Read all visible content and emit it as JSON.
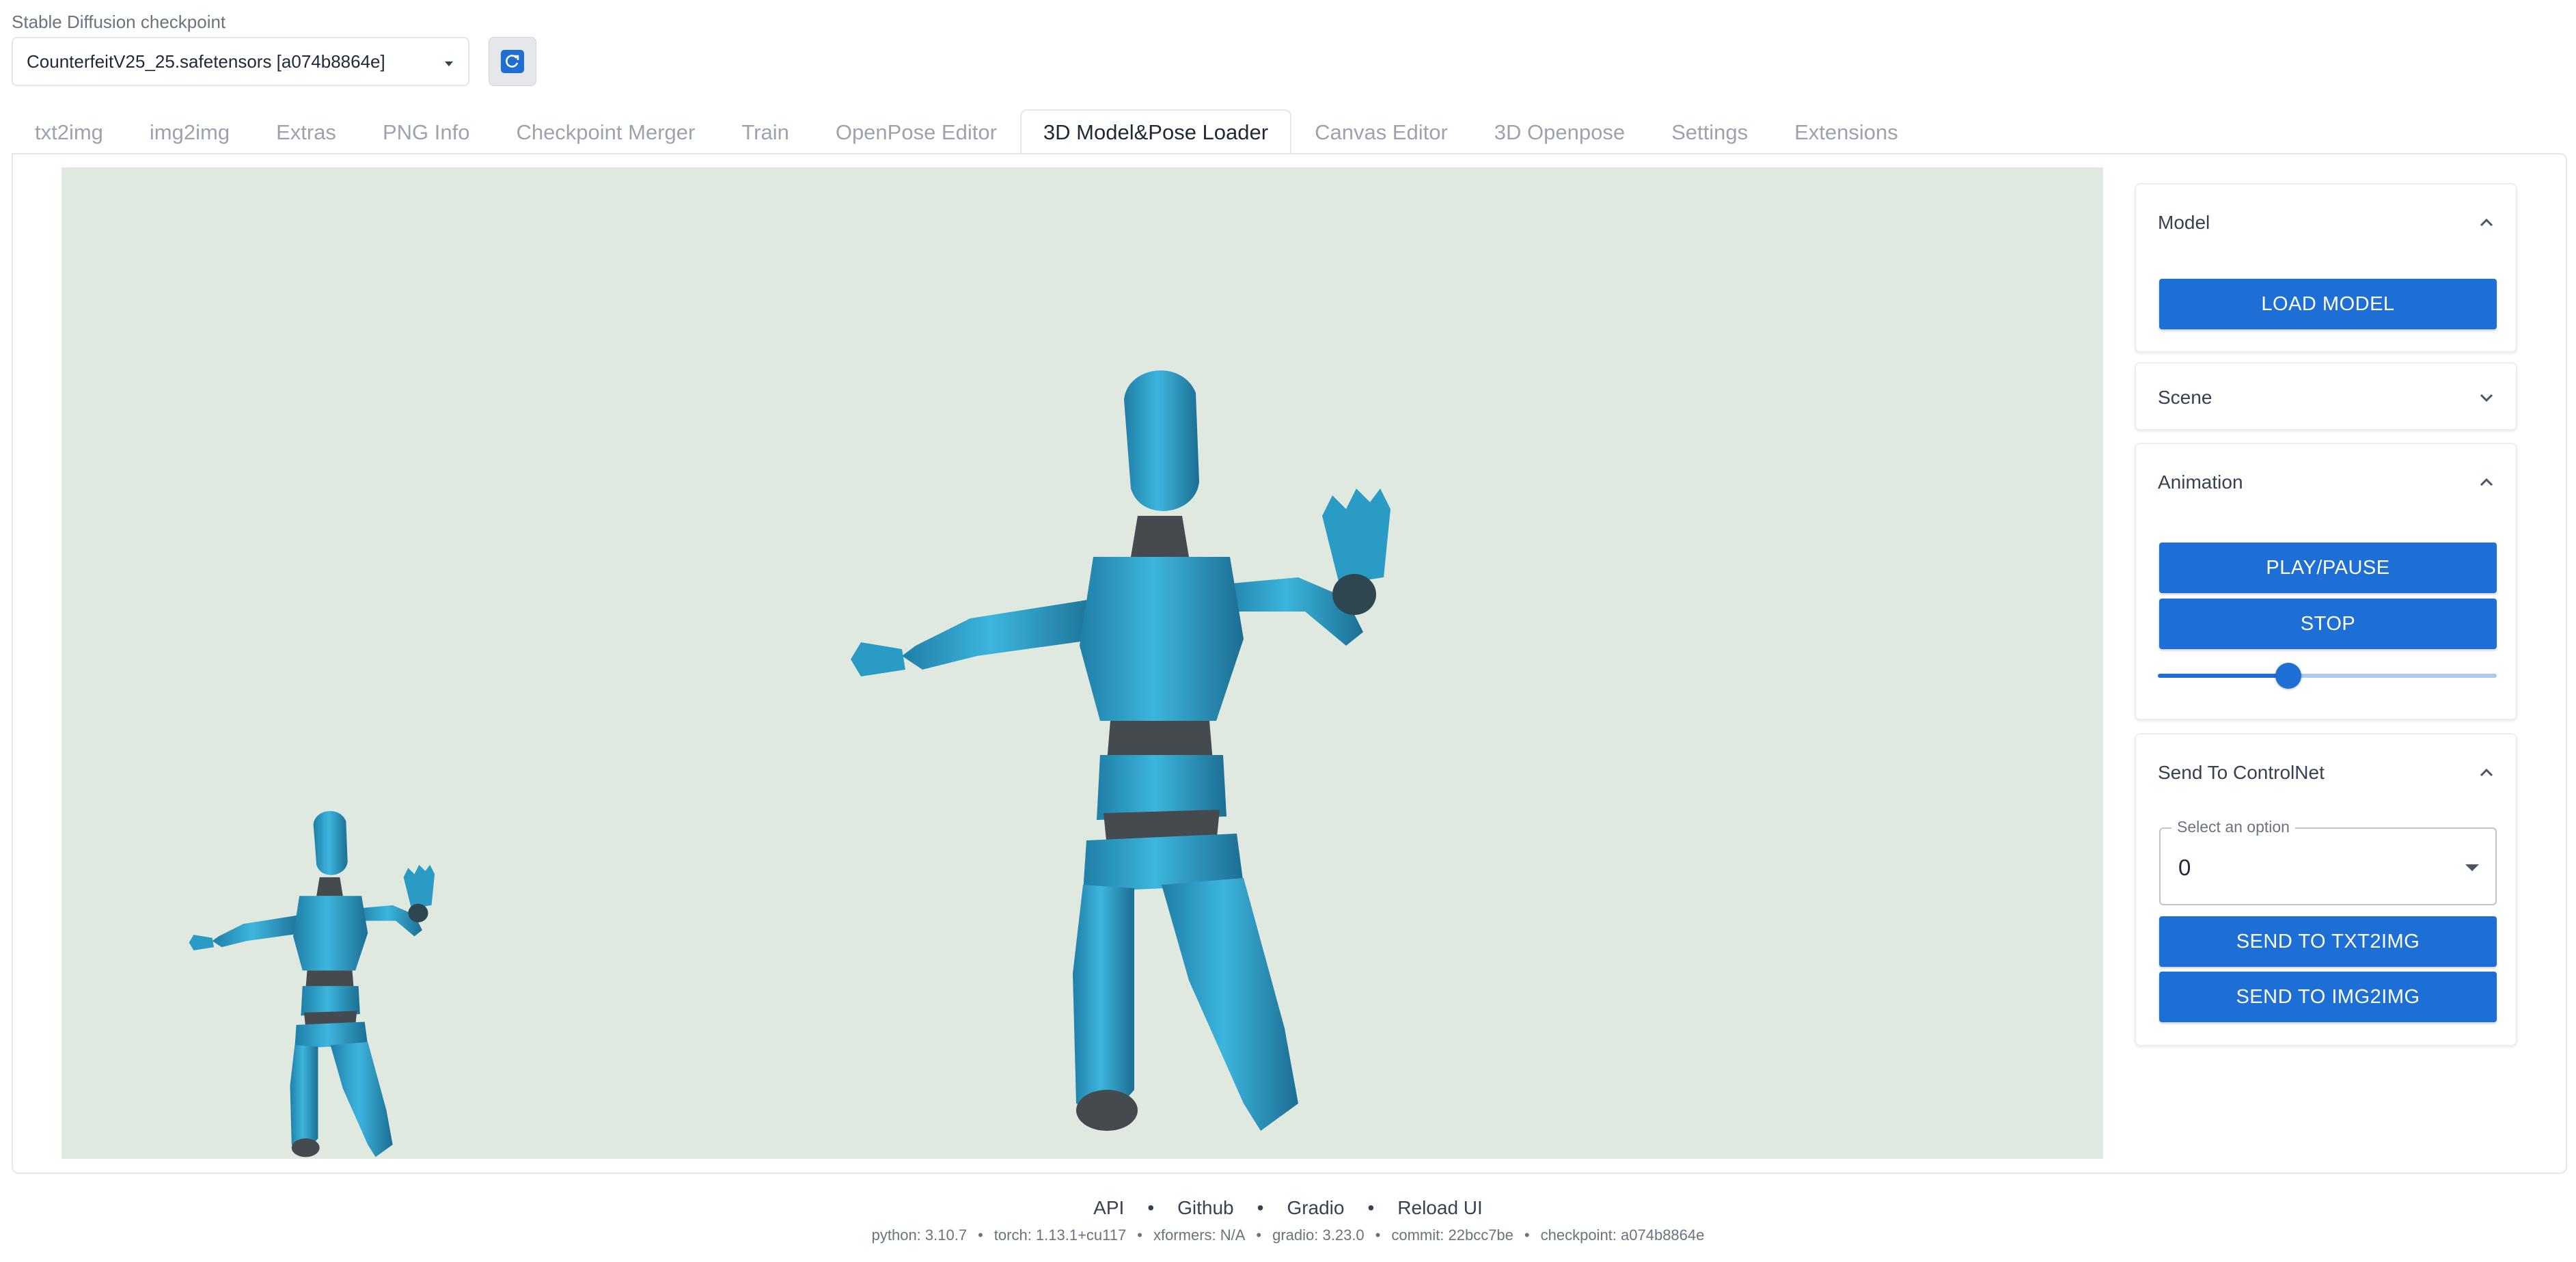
{
  "checkpoint": {
    "label": "Stable Diffusion checkpoint",
    "value": "CounterfeitV25_25.safetensors [a074b8864e]"
  },
  "tabs": [
    {
      "label": "txt2img",
      "active": false
    },
    {
      "label": "img2img",
      "active": false
    },
    {
      "label": "Extras",
      "active": false
    },
    {
      "label": "PNG Info",
      "active": false
    },
    {
      "label": "Checkpoint Merger",
      "active": false
    },
    {
      "label": "Train",
      "active": false
    },
    {
      "label": "OpenPose Editor",
      "active": false
    },
    {
      "label": "3D Model&Pose Loader",
      "active": true
    },
    {
      "label": "Canvas Editor",
      "active": false
    },
    {
      "label": "3D Openpose",
      "active": false
    },
    {
      "label": "Settings",
      "active": false
    },
    {
      "label": "Extensions",
      "active": false
    }
  ],
  "viewport": {
    "background": "#dfe9e0",
    "figure_color": "#35a9d2",
    "joint_color": "#454a4f"
  },
  "panel": {
    "model": {
      "title": "Model",
      "expanded": true,
      "load_label": "LOAD MODEL"
    },
    "scene": {
      "title": "Scene",
      "expanded": false
    },
    "animation": {
      "title": "Animation",
      "expanded": true,
      "play_label": "PLAY/PAUSE",
      "stop_label": "STOP",
      "progress": 0.385
    },
    "controlnet": {
      "title": "Send To ControlNet",
      "expanded": true,
      "select_legend": "Select an option",
      "select_value": "0",
      "txt2img_label": "SEND TO TXT2IMG",
      "img2img_label": "SEND TO IMG2IMG"
    }
  },
  "accent": "#1d6fd6",
  "footer": {
    "links": [
      "API",
      "Github",
      "Gradio",
      "Reload UI"
    ],
    "info": [
      "python: 3.10.7",
      "torch: 1.13.1+cu117",
      "xformers: N/A",
      "gradio: 3.23.0",
      "commit: 22bcc7be",
      "checkpoint: a074b8864e"
    ]
  }
}
